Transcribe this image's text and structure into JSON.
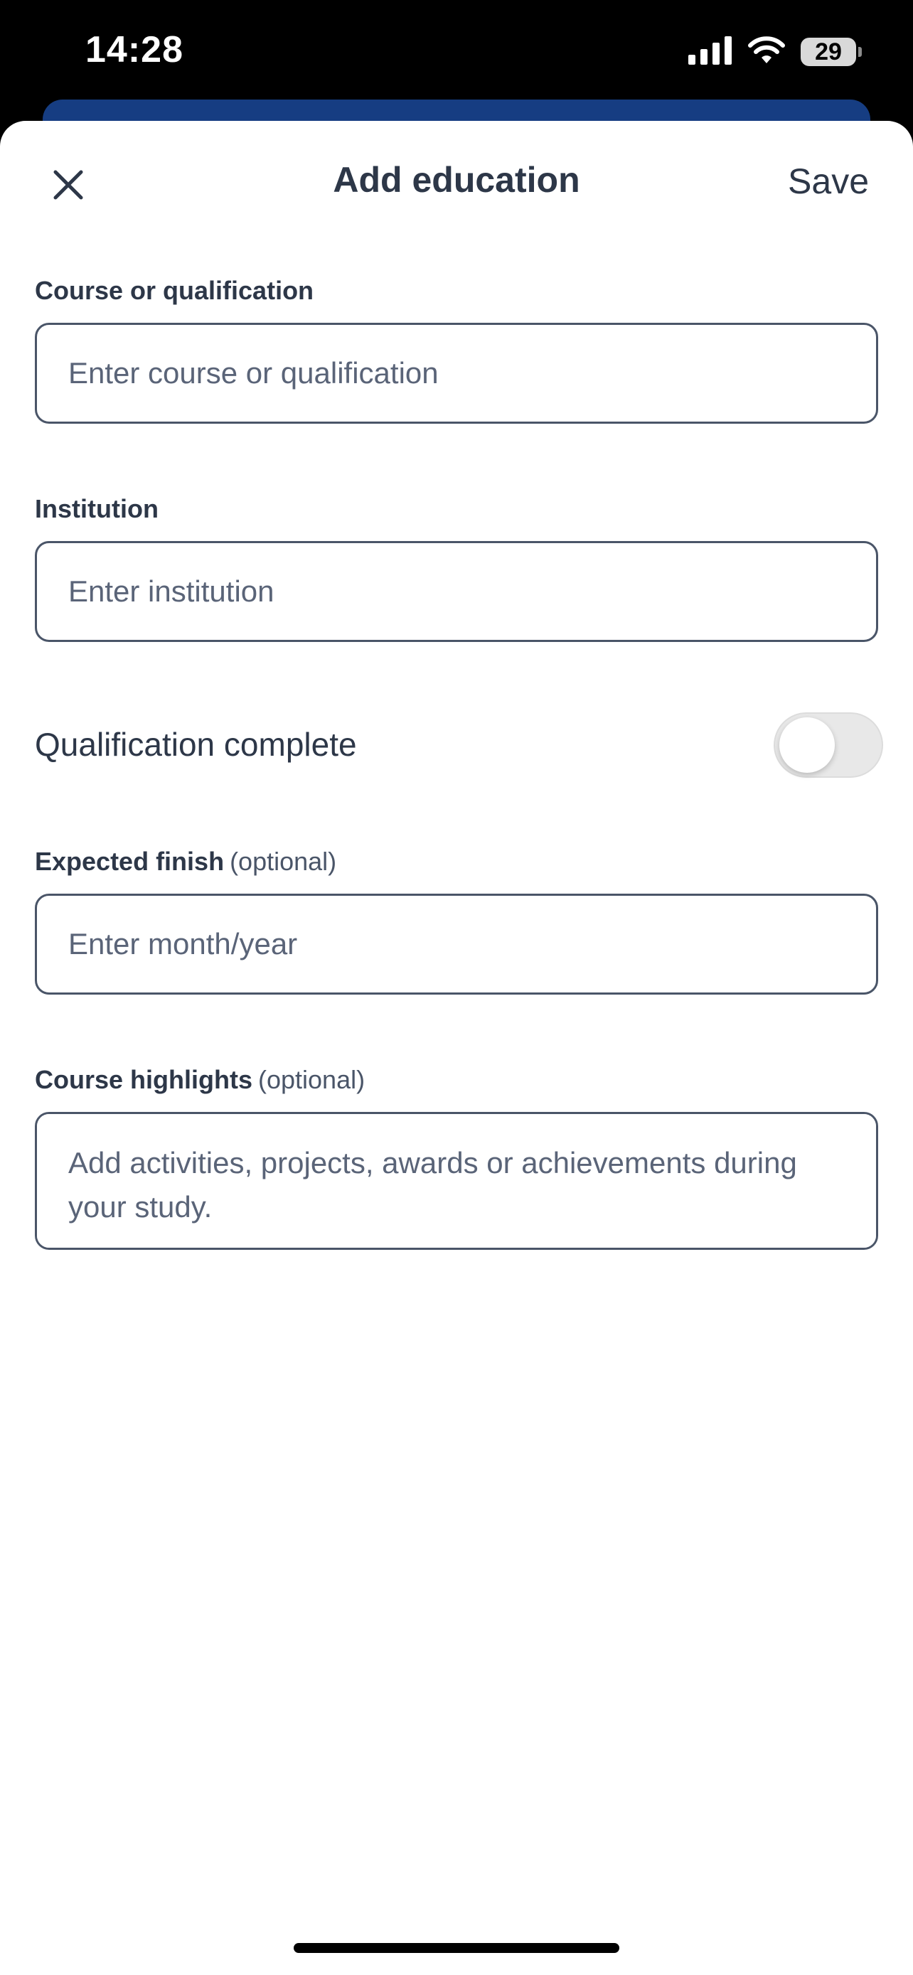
{
  "status_bar": {
    "time": "14:28",
    "battery_level": "29"
  },
  "header": {
    "title": "Add education",
    "save_label": "Save",
    "close_icon": "close-icon"
  },
  "fields": {
    "course": {
      "label": "Course or qualification",
      "placeholder": "Enter course or qualification",
      "value": ""
    },
    "institution": {
      "label": "Institution",
      "placeholder": "Enter institution",
      "value": ""
    },
    "qualification_complete": {
      "label": "Qualification complete",
      "checked": false
    },
    "expected_finish": {
      "label": "Expected finish",
      "optional": "(optional)",
      "placeholder": "Enter month/year",
      "value": ""
    },
    "highlights": {
      "label": "Course highlights",
      "optional": "(optional)",
      "placeholder": "Add activities, projects, awards or achievements during your study.",
      "value": ""
    }
  },
  "colors": {
    "text": "#2d3748",
    "border": "#4a5568",
    "underlying_header": "#163d82",
    "toggle_off": "#e8e8e8"
  }
}
